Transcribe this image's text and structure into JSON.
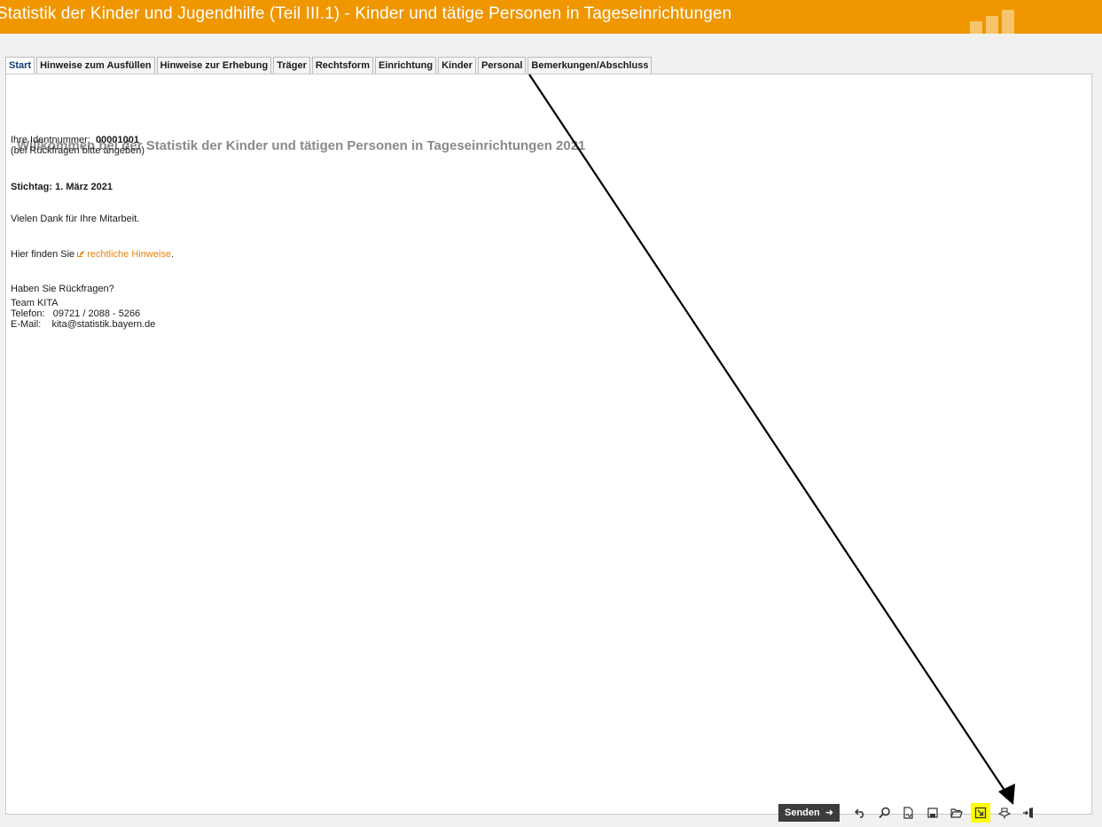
{
  "header": {
    "title": "Statistik der Kinder und Jugendhilfe (Teil III.1) - Kinder und tätige Personen in Tageseinrichtungen"
  },
  "tabs": [
    {
      "label": "Start",
      "active": true
    },
    {
      "label": "Hinweise zum Ausfüllen"
    },
    {
      "label": "Hinweise zur Erhebung"
    },
    {
      "label": "Träger"
    },
    {
      "label": "Rechtsform"
    },
    {
      "label": "Einrichtung"
    },
    {
      "label": "Kinder"
    },
    {
      "label": "Personal"
    },
    {
      "label": "Bemerkungen/Abschluss"
    }
  ],
  "content": {
    "heading": "Willkommen bei der Statistik der Kinder und tätigen Personen in Tageseinrichtungen 2021",
    "id_label": "Ihre Identnummer:",
    "id_value": "00001001",
    "id_note": "(bei Rückfragen bitte angeben)",
    "stichtag": "Stichtag: 1. März 2021",
    "thanks": "Vielen Dank für Ihre Mitarbeit.",
    "legal_prefix": "Hier finden Sie",
    "legal_link": "rechtliche Hinweise",
    "legal_suffix": ".",
    "questions": "Haben Sie Rückfragen?",
    "team": "Team KITA",
    "phone_label": "Telefon:",
    "phone": "09721 / 2088 - 5266",
    "email_label": "E-Mail:",
    "email": "kita@statistik.bayern.de"
  },
  "toolbar": {
    "send_label": "Senden",
    "icons": [
      "undo-icon",
      "search-icon",
      "document-sign-icon",
      "save-icon",
      "open-folder-icon",
      "export-icon",
      "print-icon",
      "exit-icon"
    ],
    "highlighted": "export-icon"
  },
  "colors": {
    "header_bg": "#ef9600",
    "link": "#e8820c",
    "highlight": "#ffff00",
    "send_bg": "#3c3c3c"
  }
}
